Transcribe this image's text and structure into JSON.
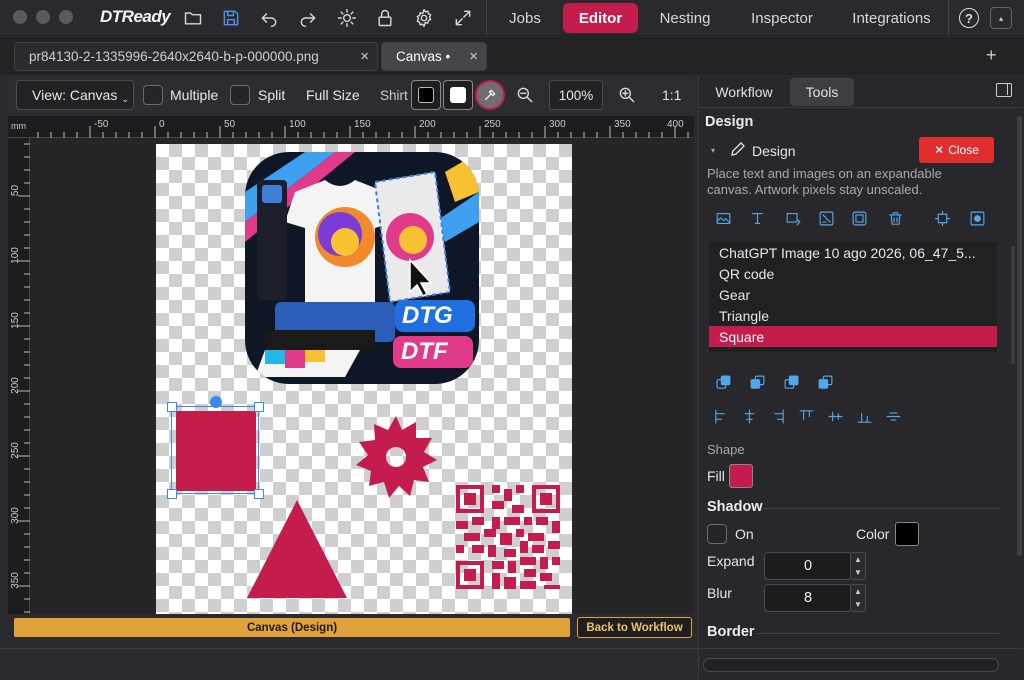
{
  "app": {
    "logo_text": "DTReady"
  },
  "nav": {
    "tabs": [
      "Jobs",
      "Editor",
      "Nesting",
      "Inspector",
      "Integrations"
    ],
    "active": "Editor"
  },
  "doc_tabs": [
    {
      "label": "pr84130-2-1335996-2640x2640-b-p-000000.png",
      "close": "×"
    },
    {
      "label": "Canvas •",
      "close": "×"
    }
  ],
  "add_tab": "+",
  "toolbar": {
    "view_select": "View: Canvas",
    "multiple": "Multiple",
    "split": "Split",
    "full_size": "Full Size",
    "shirt": "Shirt",
    "zoom": "100%",
    "one_to_one": "1:1",
    "shirt_color_black": "#000000",
    "shirt_color_white": "#ffffff"
  },
  "ruler": {
    "unit": "mm",
    "top_labels": [
      "-50",
      "0",
      "50",
      "100",
      "150",
      "200",
      "250",
      "300",
      "350",
      "400"
    ],
    "left_labels": [
      "50",
      "100",
      "150",
      "200",
      "250",
      "300",
      "350"
    ]
  },
  "artwork": {
    "badge_top": "DTG",
    "badge_bottom": "DTF",
    "accent_color": "#c41d4d"
  },
  "status": {
    "mode": "Canvas (Design)",
    "back_button": "Back to Workflow"
  },
  "panel": {
    "tabs": [
      "Workflow",
      "Tools"
    ],
    "active_tab": "Tools",
    "section_title": "Design",
    "design_label": "Design",
    "close_button": "Close",
    "description": "Place text and images on an expandable canvas. Artwork pixels stay unscaled.",
    "layers": [
      "ChatGPT Image 10 ago 2026, 06_47_5...",
      "QR code",
      "Gear",
      "Triangle",
      "Square"
    ],
    "selected_layer": "Square",
    "shape_section": "Shape",
    "fill_label": "Fill",
    "fill_color": "#c41d4d",
    "shadow_section": "Shadow",
    "shadow_on_label": "On",
    "color_label": "Color",
    "shadow_color": "#000000",
    "expand_label": "Expand",
    "expand_value": "0",
    "blur_label": "Blur",
    "blur_value": "8",
    "border_section": "Border"
  }
}
